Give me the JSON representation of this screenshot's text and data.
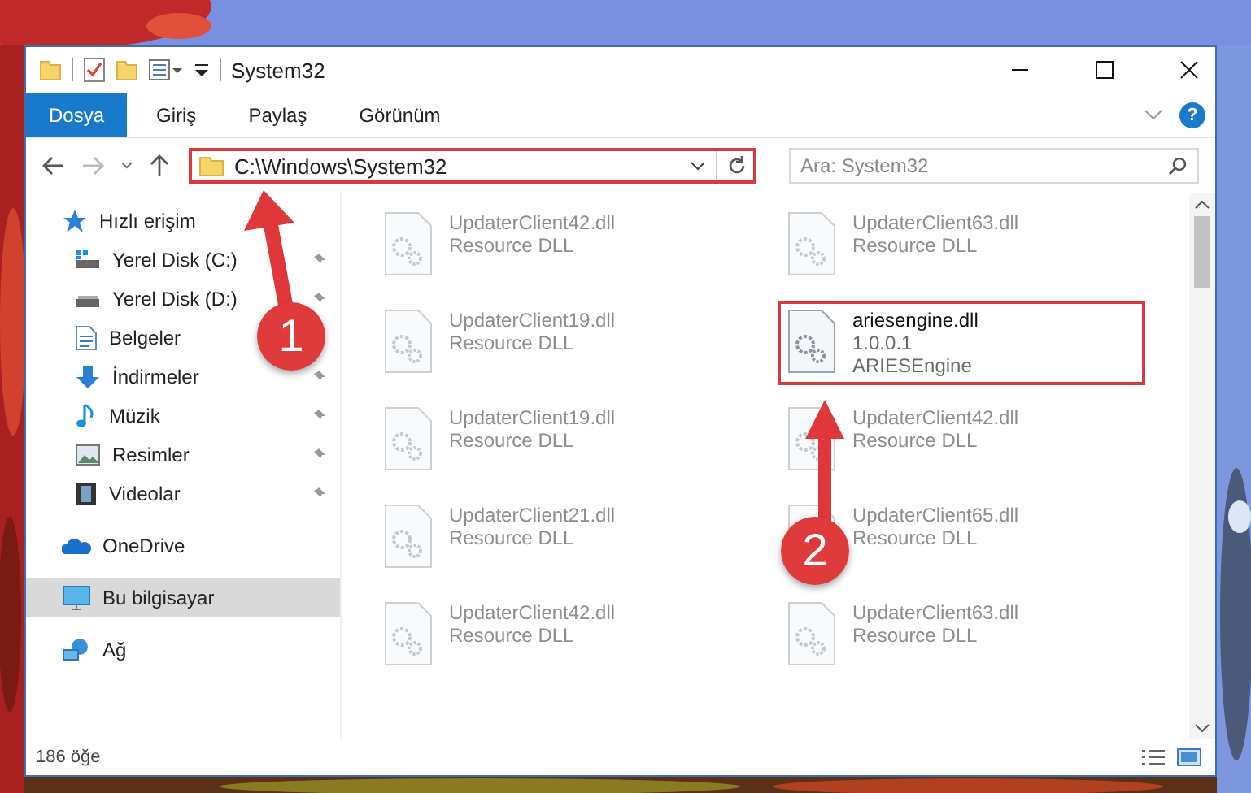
{
  "window": {
    "title": "System32"
  },
  "ribbon": {
    "tabs": [
      {
        "label": "Dosya",
        "selected": true
      },
      {
        "label": "Giriş",
        "selected": false
      },
      {
        "label": "Paylaş",
        "selected": false
      },
      {
        "label": "Görünüm",
        "selected": false
      }
    ],
    "help": "?"
  },
  "address": {
    "path": "C:\\Windows\\System32",
    "highlighted": true
  },
  "search": {
    "placeholder": "Ara: System32"
  },
  "sidebar": {
    "items": [
      {
        "label": "Hızlı erişim",
        "kind": "star",
        "selected": false,
        "children": [
          {
            "label": "Yerel Disk (C:)",
            "kind": "systemdrive",
            "pinned": true
          },
          {
            "label": "Yerel Disk (D:)",
            "kind": "drive",
            "pinned": true
          },
          {
            "label": "Belgeler",
            "kind": "documents",
            "pinned": false
          },
          {
            "label": "İndirmeler",
            "kind": "downloads",
            "pinned": true
          },
          {
            "label": "Müzik",
            "kind": "music",
            "pinned": true
          },
          {
            "label": "Resimler",
            "kind": "pictures",
            "pinned": true
          },
          {
            "label": "Videolar",
            "kind": "videos",
            "pinned": true
          }
        ]
      },
      {
        "label": "OneDrive",
        "kind": "cloud",
        "selected": false
      },
      {
        "label": "Bu bilgisayar",
        "kind": "computer",
        "selected": true
      },
      {
        "label": "Ağ",
        "kind": "network",
        "selected": false
      }
    ]
  },
  "files": [
    {
      "name": "UpdaterClient42.dll",
      "lines": [
        "Resource DLL"
      ],
      "blurred": true,
      "highlighted": false
    },
    {
      "name": "UpdaterClient63.dll",
      "lines": [
        "Resource DLL"
      ],
      "blurred": true,
      "highlighted": false
    },
    {
      "name": "UpdaterClient19.dll",
      "lines": [
        "Resource DLL"
      ],
      "blurred": true,
      "highlighted": false
    },
    {
      "name": "ariesengine.dll",
      "lines": [
        "1.0.0.1",
        "ARIESEngine"
      ],
      "blurred": false,
      "highlighted": true
    },
    {
      "name": "UpdaterClient19.dll",
      "lines": [
        "Resource DLL"
      ],
      "blurred": true,
      "highlighted": false
    },
    {
      "name": "UpdaterClient42.dll",
      "lines": [
        "Resource DLL"
      ],
      "blurred": true,
      "highlighted": false
    },
    {
      "name": "UpdaterClient21.dll",
      "lines": [
        "Resource DLL"
      ],
      "blurred": true,
      "highlighted": false
    },
    {
      "name": "UpdaterClient65.dll",
      "lines": [
        "Resource DLL"
      ],
      "blurred": true,
      "highlighted": false
    },
    {
      "name": "UpdaterClient42.dll",
      "lines": [
        "Resource DLL"
      ],
      "blurred": true,
      "highlighted": false
    },
    {
      "name": "UpdaterClient63.dll",
      "lines": [
        "Resource DLL"
      ],
      "blurred": true,
      "highlighted": false
    }
  ],
  "status_bar": {
    "count": "186 öğe"
  },
  "annotations": [
    {
      "label": "1"
    },
    {
      "label": "2"
    }
  ]
}
